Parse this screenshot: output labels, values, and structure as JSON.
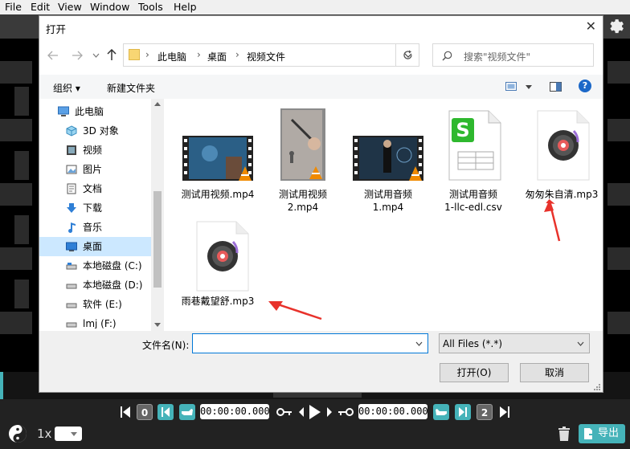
{
  "menu": [
    "File",
    "Edit",
    "View",
    "Window",
    "Tools",
    "Help"
  ],
  "dialog": {
    "title": "打开",
    "close_label": "✕",
    "breadcrumb": [
      "此电脑",
      "桌面",
      "视频文件"
    ],
    "search_placeholder": "搜索\"视频文件\"",
    "organize_label": "组织 ▾",
    "new_folder_label": "新建文件夹",
    "nav_items": [
      {
        "label": "此电脑",
        "icon": "computer-icon"
      },
      {
        "label": "3D 对象",
        "icon": "3d-objects-icon"
      },
      {
        "label": "视频",
        "icon": "video-folder-icon"
      },
      {
        "label": "图片",
        "icon": "pictures-folder-icon"
      },
      {
        "label": "文档",
        "icon": "documents-folder-icon"
      },
      {
        "label": "下载",
        "icon": "downloads-icon"
      },
      {
        "label": "音乐",
        "icon": "music-icon"
      },
      {
        "label": "桌面",
        "icon": "desktop-icon"
      },
      {
        "label": "本地磁盘 (C:)",
        "icon": "drive-icon"
      },
      {
        "label": "本地磁盘 (D:)",
        "icon": "drive-icon"
      },
      {
        "label": "软件 (E:)",
        "icon": "drive-icon"
      },
      {
        "label": "lmj (F:)",
        "icon": "drive-icon"
      }
    ],
    "files": [
      {
        "line1": "测试用视频.mp4",
        "line2": "",
        "type": "video"
      },
      {
        "line1": "测试用视频",
        "line2": "2.mp4",
        "type": "video-portrait"
      },
      {
        "line1": "测试用音频",
        "line2": "1.mp4",
        "type": "video"
      },
      {
        "line1": "测试用音频",
        "line2": "1-llc-edl.csv",
        "type": "csv"
      },
      {
        "line1": "匆匆朱自清.mp3",
        "line2": "",
        "type": "audio"
      },
      {
        "line1": "雨巷戴望舒.mp3",
        "line2": "",
        "type": "audio"
      }
    ],
    "filename_label": "文件名(N):",
    "filename_value": "",
    "filter_value": "All Files (*.*)",
    "open_label": "打开(O)",
    "cancel_label": "取消"
  },
  "player": {
    "start_marker": "0",
    "time_start": "00:00:00.000",
    "time_end": "00:00:00.000",
    "end_marker": "2",
    "speed": "1x",
    "export_label": "导出"
  },
  "colors": {
    "accent": "#0078d7",
    "teal": "#45b3b9",
    "arrow": "#e8322b"
  }
}
